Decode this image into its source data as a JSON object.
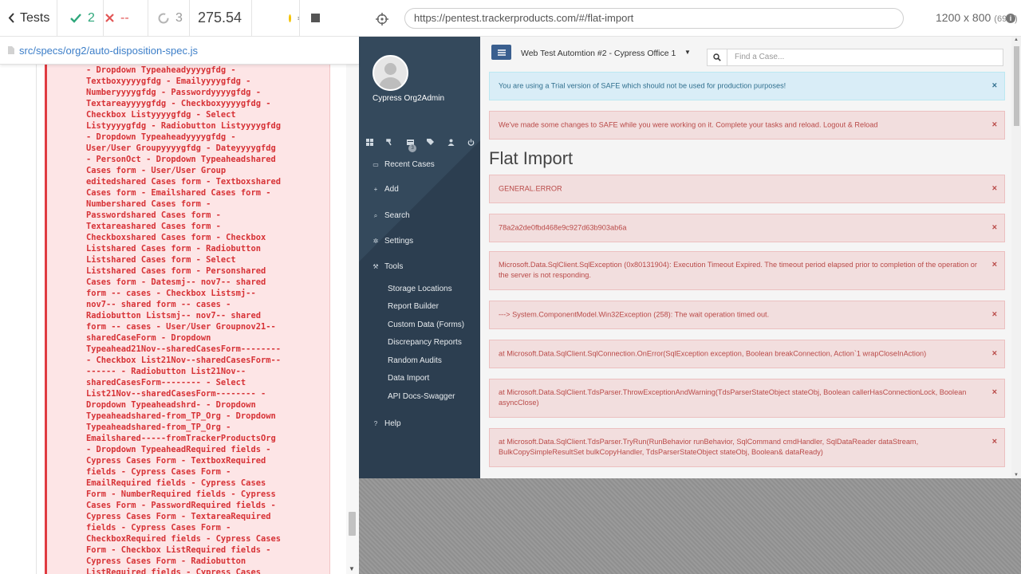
{
  "runner": {
    "tests_label": "Tests",
    "passed": "2",
    "failed": "--",
    "pending": "3",
    "duration": "275.54",
    "spec_path": "src/specs/org2/auto-disposition-spec.js",
    "error_text": "- Dropdown Typeaheadyyyygfdg -\nTextboxyyyygfdg - Emailyyyygfdg -\nNumberyyyygfdg - Passwordyyyygfdg -\nTextareayyyygfdg - Checkboxyyyygfdg -\nCheckbox Listyyyygfdg - Select\nListyyyygfdg - Radiobutton Listyyyygfdg\n- Dropdown Typeaheadyyyygfdg -\nUser/User Groupyyyygfdg - Dateyyyygfdg\n- PersonOct - Dropdown Typeaheadshared\nCases form - User/User Group\neditedshared Cases form - Textboxshared\nCases form - Emailshared Cases form -\nNumbershared Cases form -\nPasswordshared Cases form -\nTextareashared Cases form -\nCheckboxshared Cases form - Checkbox\nListshared Cases form - Radiobutton\nListshared Cases form - Select\nListshared Cases form - Personshared\nCases form - Datesmj-- nov7-- shared\nform -- cases - Checkbox Listsmj--\nnov7-- shared form -- cases -\nRadiobutton Listsmj-- nov7-- shared\nform -- cases - User/User Groupnov21--\nsharedCaseForm - Dropdown\nTypeahead21Nov--sharedCasesForm--------\n- Checkbox List21Nov--sharedCasesForm--\n------ - Radiobutton List21Nov--\nsharedCasesForm-------- - Select\nList21Nov--sharedCasesForm-------- -\nDropdown Typeaheadshrd- - Dropdown\nTypeaheadshared-from_TP_Org - Dropdown\nTypeaheadshared-from_TP_Org -\nEmailshared-----fromTrackerProductsOrg\n- Dropdown TypeaheadRequired fields -\nCypress Cases Form - TextboxRequired\nfields - Cypress Cases Form -\nEmailRequired fields - Cypress Cases\nForm - NumberRequired fields - Cypress\nCases Form - PasswordRequired fields -\nCypress Cases Form - TextareaRequired\nfields - Cypress Cases Form -\nCheckboxRequired fields - Cypress Cases\nForm - Checkbox ListRequired fields -\nCypress Cases Form - Radiobutton\nListRequired fields - Cypress Cases\nForm - Select ListRequired fields -"
  },
  "aut": {
    "url": "https://pentest.trackerproducts.com/#/flat-import",
    "viewport": "1200 x 800",
    "scale": "(69%)"
  },
  "app": {
    "user_name": "Cypress Org2Admin",
    "badge": "3",
    "office": "Web Test Automtion #2 - Cypress Office 1",
    "search_placeholder": "Find a Case...",
    "nav": {
      "recent_cases": "Recent Cases",
      "add": "Add",
      "search": "Search",
      "settings": "Settings",
      "tools": "Tools",
      "help": "Help"
    },
    "tools_sub": [
      "Storage Locations",
      "Report Builder",
      "Custom Data (Forms)",
      "Discrepancy Reports",
      "Random Audits",
      "Data Import",
      "API Docs-Swagger"
    ],
    "trial_alert": "You are using a Trial version of SAFE which should not be used for production purposes!",
    "changes_alert": "We've made some changes to SAFE while you were working on it. Complete your tasks and reload.   Logout & Reload",
    "page_title": "Flat Import",
    "errors": [
      "GENERAL.ERROR",
      "78a2a2de0fbd468e9c927d63b903ab6a",
      "Microsoft.Data.SqlClient.SqlException (0x80131904): Execution Timeout Expired. The timeout period elapsed prior to completion of the operation or the server is not responding.",
      "---> System.ComponentModel.Win32Exception (258): The wait operation timed out.",
      "at Microsoft.Data.SqlClient.SqlConnection.OnError(SqlException exception, Boolean breakConnection, Action`1 wrapCloseInAction)",
      "at Microsoft.Data.SqlClient.TdsParser.ThrowExceptionAndWarning(TdsParserStateObject stateObj, Boolean callerHasConnectionLock, Boolean asyncClose)",
      "at Microsoft.Data.SqlClient.TdsParser.TryRun(RunBehavior runBehavior, SqlCommand cmdHandler, SqlDataReader dataStream, BulkCopySimpleResultSet bulkCopyHandler, TdsParserStateObject stateObj, Boolean& dataReady)"
    ]
  }
}
